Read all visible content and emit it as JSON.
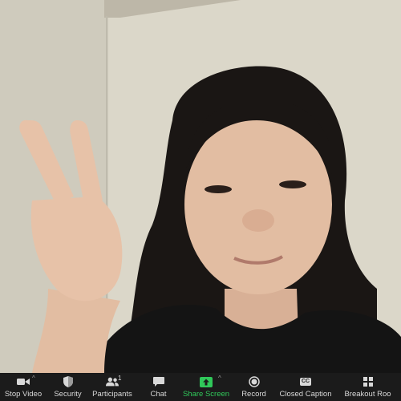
{
  "toolbar": {
    "stop_video_label": "Stop Video",
    "security_label": "Security",
    "participants_label": "Participants",
    "participants_count": "1",
    "chat_label": "Chat",
    "share_screen_label": "Share Screen",
    "record_label": "Record",
    "closed_caption_label": "Closed Caption",
    "closed_caption_icon_text": "CC",
    "breakout_rooms_label": "Breakout Roo"
  },
  "icons": {
    "stop_video": "video-camera-icon",
    "security": "shield-icon",
    "participants": "participants-icon",
    "chat": "chat-bubble-icon",
    "share_screen": "share-screen-arrow-icon",
    "record": "record-icon",
    "closed_caption": "cc-icon",
    "breakout_rooms": "grid-icon"
  },
  "colors": {
    "toolbar_bg": "#1b1b1b",
    "share_accent": "#30c85a",
    "label": "#d8d8d8"
  }
}
